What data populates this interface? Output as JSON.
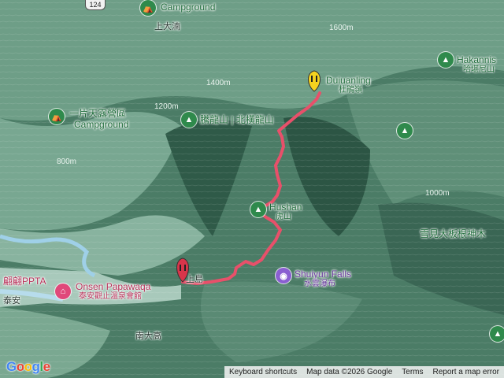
{
  "road_shield": "124",
  "labels": {
    "campground_top_label": "Campground",
    "shangdatan": "上大湳",
    "hakannis_en": "Hakannis",
    "hakannis_zh": "哈堪尼山",
    "duiuanling_en": "Duiuanling",
    "duiuanling_zh": "杜鵑嶺",
    "campground_left_zh": "一片天露營區",
    "campground_left_en": "Campground",
    "tenglongshan": "騰龍山 | 北橫龍山",
    "hushan_en": "Hushan",
    "hushan_zh": "虎山",
    "xuejian_zh": "雪見大板根神木",
    "shuiyun_en": "Shuiyun Falls",
    "shuiyun_zh": "水雲瀑布",
    "ppta": "翩翩PPTA",
    "onsen_en": "Onsen Papawaqa",
    "onsen_zh": "泰安觀止溫泉會館",
    "taian": "泰安",
    "nandagao": "南大高",
    "start_label": "上島",
    "elev_1": "1400m",
    "elev_2": "1600m",
    "elev_3": "1200m",
    "elev_4": "800m",
    "elev_5": "1000m"
  },
  "attribution": {
    "keyboard": "Keyboard shortcuts",
    "mapdata": "Map data ©2026 Google",
    "terms": "Terms",
    "report": "Report a map error"
  },
  "logo": "Google",
  "colors": {
    "route": "#e8506a",
    "poi_green": "#2f8a4c",
    "poi_pink": "#e0487a",
    "poi_purple": "#8a5fd1",
    "end_marker": "#f5d21f",
    "start_marker": "#d8354a"
  },
  "icons": {
    "poi_mountain": "mountain-icon",
    "poi_camp": "campground-icon",
    "poi_photo": "camera-icon",
    "poi_hotel": "hotel-icon"
  }
}
